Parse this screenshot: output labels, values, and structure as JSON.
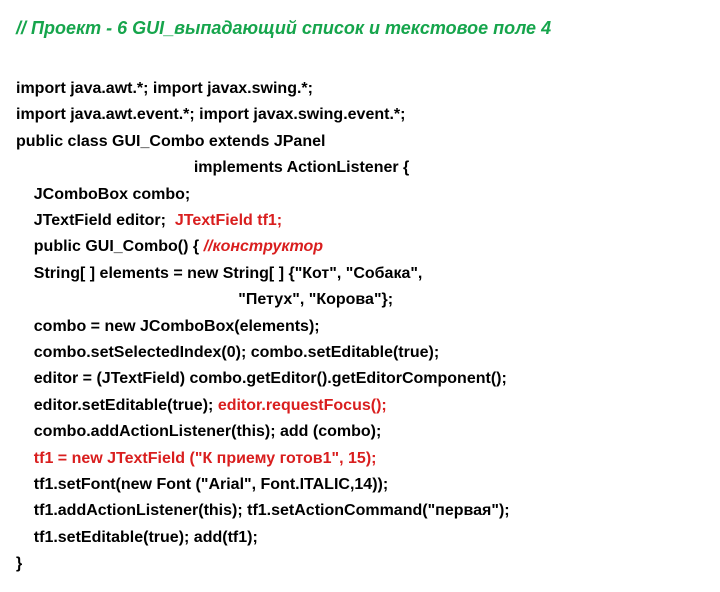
{
  "title": "// Проект - 6 GUI_выпадающий список и текстовое поле 4",
  "code": {
    "l1": "import java.awt.*; import javax.swing.*;",
    "l2": "import java.awt.event.*; import javax.swing.event.*;",
    "l3": "public class GUI_Combo extends JPanel",
    "l4": "                                        implements ActionListener {",
    "l5a": "    JComboBox combo;",
    "l6a": "    JTextField editor;  ",
    "l6b": "JTextField tf1;",
    "l7a": "    public GUI_Combo() { ",
    "l7b": "//конструктор",
    "l8": "    String[ ] elements = new String[ ] {\"Кот\", \"Собака\",",
    "l9": "                                                  \"Петух\", \"Корова\"};",
    "l10": "    combo = new JComboBox(elements);",
    "l11": "    combo.setSelectedIndex(0); combo.setEditable(true);",
    "l12": "    editor = (JTextField) combo.getEditor().getEditorComponent();",
    "l13a": "    editor.setEditable(true); ",
    "l13b": "editor.requestFocus();",
    "l14": "    combo.addActionListener(this); add (combo);",
    "l15": "    tf1 = new JTextField (\"К приему готов1\", 15);",
    "l16": "    tf1.setFont(new Font (\"Arial\", Font.ITALIC,14));",
    "l17": "    tf1.addActionListener(this); tf1.setActionCommand(\"первая\");",
    "l18": "    tf1.setEditable(true); add(tf1);",
    "l19": "}"
  }
}
